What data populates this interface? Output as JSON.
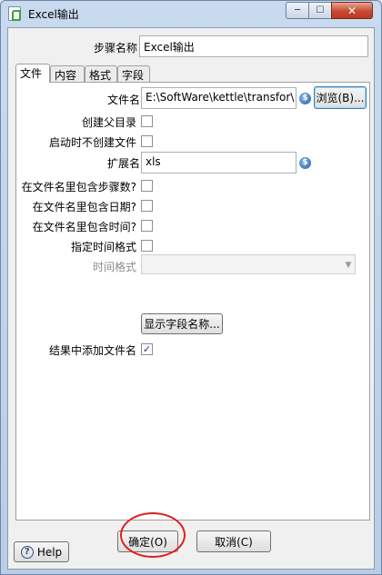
{
  "window": {
    "title": "Excel输出",
    "controls": {
      "minimize": "─",
      "maximize": "☐",
      "close": "✕"
    }
  },
  "step_name": {
    "label": "步骤名称",
    "value": "Excel输出"
  },
  "tabs": [
    {
      "label": "文件",
      "active": true
    },
    {
      "label": "内容",
      "active": false
    },
    {
      "label": "格式",
      "active": false
    },
    {
      "label": "字段",
      "active": false
    }
  ],
  "file": {
    "filename_label": "文件名",
    "filename_value": "E:\\SoftWare\\kettle\\transfor\\",
    "browse_label": "浏览(B)...",
    "create_parent_label": "创建父目录",
    "create_parent_checked": false,
    "no_create_on_start_label": "启动时不创建文件",
    "no_create_on_start_checked": false,
    "extension_label": "扩展名",
    "extension_value": "xls",
    "include_step_label": "在文件名里包含步骤数?",
    "include_step_checked": false,
    "include_date_label": "在文件名里包含日期?",
    "include_date_checked": false,
    "include_time_label": "在文件名里包含时间?",
    "include_time_checked": false,
    "specify_format_label": "指定时间格式",
    "specify_format_checked": false,
    "time_format_label": "时间格式",
    "time_format_value": "",
    "show_fields_label": "显示字段名称...",
    "add_to_result_label": "结果中添加文件名",
    "add_to_result_checked": true
  },
  "footer": {
    "help_label": "Help",
    "ok_label": "确定(O)",
    "cancel_label": "取消(C)"
  },
  "icons": {
    "variable": "$",
    "checkmark": "✓",
    "dropdown": "▼",
    "help": "?"
  },
  "annotation": {
    "color": "#e02020"
  }
}
